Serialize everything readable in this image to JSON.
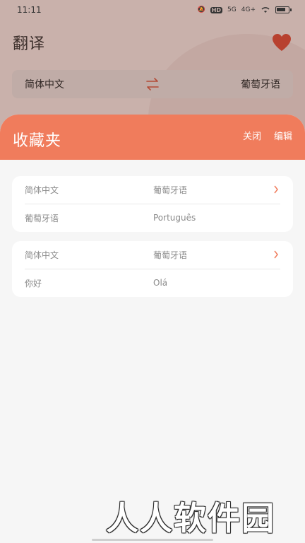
{
  "status_bar": {
    "time": "11:11",
    "hd": "HD",
    "net1": "5G",
    "net2": "4G+"
  },
  "header": {
    "title": "翻译",
    "heart_icon": "heart-icon"
  },
  "language_bar": {
    "source": "简体中文",
    "target": "葡萄牙语",
    "swap_icon": "swap-arrows-icon"
  },
  "favorites": {
    "title": "收藏夹",
    "close_label": "关闭",
    "edit_label": "编辑",
    "items": [
      {
        "source_lang": "简体中文",
        "target_lang": "葡萄牙语",
        "source_text": "葡萄牙语",
        "target_text": "Português"
      },
      {
        "source_lang": "简体中文",
        "target_lang": "葡萄牙语",
        "source_text": "你好",
        "target_text": "Olá"
      }
    ]
  },
  "watermark": "人人软件园",
  "colors": {
    "accent": "#f07c5c",
    "heart": "#d9483a",
    "overlay": "#c9b1ab"
  }
}
